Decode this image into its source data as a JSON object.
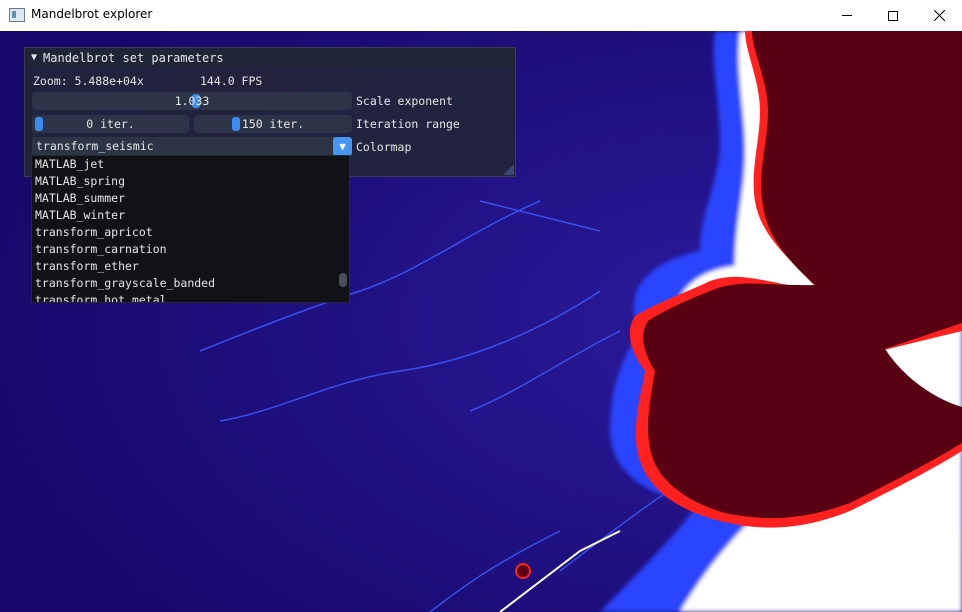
{
  "window": {
    "title": "Mandelbrot explorer"
  },
  "panel": {
    "title": "Mandelbrot set parameters",
    "zoom_text": "Zoom: 5.488e+04x",
    "fps_text": "144.0 FPS",
    "scale": {
      "value": "1.033",
      "label": "Scale exponent",
      "fraction": 0.49
    },
    "iter_min": {
      "value": "0 iter.",
      "fraction": 0.0
    },
    "iter_max": {
      "value": "150 iter.",
      "fraction": 0.25
    },
    "iter_label": "Iteration range",
    "colormap": {
      "value": "transform_seismic",
      "label": "Colormap"
    }
  },
  "dropdown": {
    "items": [
      "MATLAB_jet",
      "MATLAB_spring",
      "MATLAB_summer",
      "MATLAB_winter",
      "transform_apricot",
      "transform_carnation",
      "transform_ether",
      "transform_grayscale_banded",
      "transform_hot_metal"
    ]
  },
  "icons": {
    "app": "app-window-icon",
    "minimize": "minimize-icon",
    "maximize": "maximize-icon",
    "close": "close-icon",
    "arrow": "chevron-down-icon",
    "collapse": "triangle-down-icon"
  },
  "colors": {
    "set": "#5a0013",
    "edge_red": "#ff2020",
    "glow": "#ffffff",
    "blue": "#2a3cff",
    "background": "#1a0a6b"
  }
}
